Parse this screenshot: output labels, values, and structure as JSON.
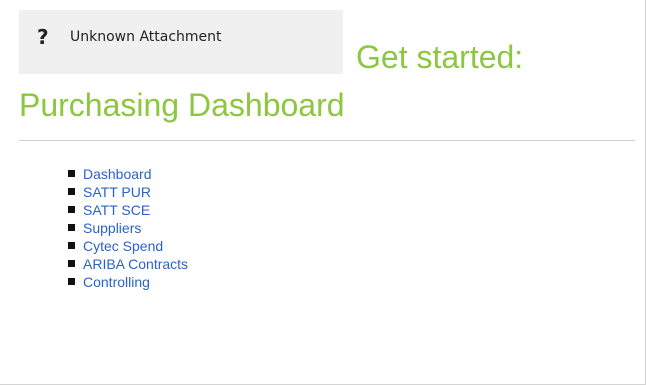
{
  "attachment": {
    "icon": "question-mark-icon",
    "icon_glyph": "?",
    "label": "Unknown Attachment"
  },
  "title": {
    "line1": "Get started:",
    "line2": "Purchasing Dashboard",
    "color": "#8dc63f"
  },
  "links": [
    {
      "label": "Dashboard"
    },
    {
      "label": "SATT PUR"
    },
    {
      "label": "SATT SCE"
    },
    {
      "label": "Suppliers"
    },
    {
      "label": "Cytec Spend"
    },
    {
      "label": "ARIBA Contracts"
    },
    {
      "label": "Controlling"
    }
  ],
  "colors": {
    "link": "#2a63c7",
    "attachment_bg": "#f0f0f0",
    "divider": "#cfcfcf"
  }
}
